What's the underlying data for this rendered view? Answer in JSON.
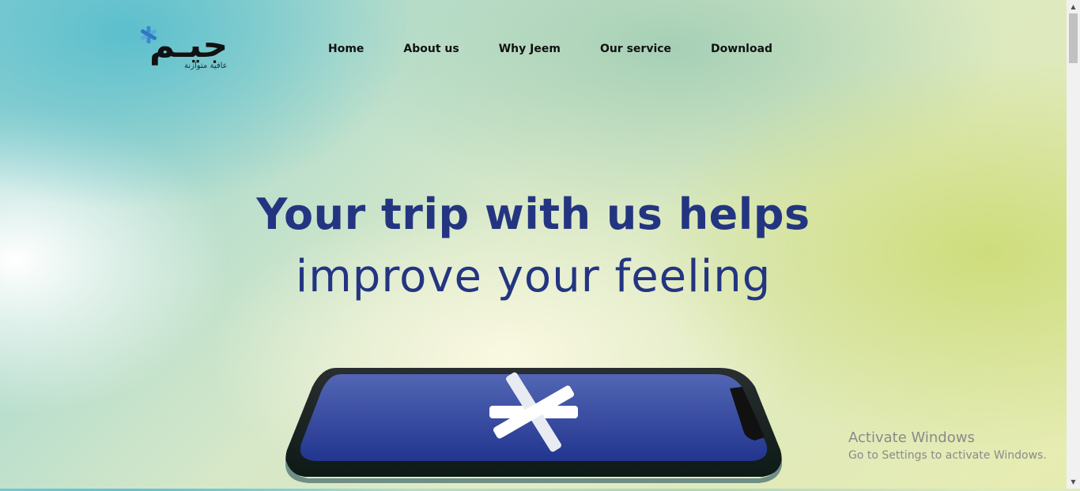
{
  "brand": {
    "logo_text": "جيـم",
    "tagline": "عافية متوازنة",
    "accent": "#3b8ad0"
  },
  "nav": {
    "items": [
      "Home",
      "About us",
      "Why Jeem",
      "Our service",
      "Download"
    ]
  },
  "hero": {
    "line1": "Your trip with us helps",
    "line2": "improve your feeling",
    "color": "#233581"
  },
  "phone": {
    "screen_color": "#2c3f99",
    "icon": "jeem-star-icon"
  },
  "watermark": {
    "title": "Activate Windows",
    "subtitle": "Go to Settings to activate Windows."
  },
  "scrollbar": {
    "up_icon": "▲",
    "down_icon": "▼"
  }
}
